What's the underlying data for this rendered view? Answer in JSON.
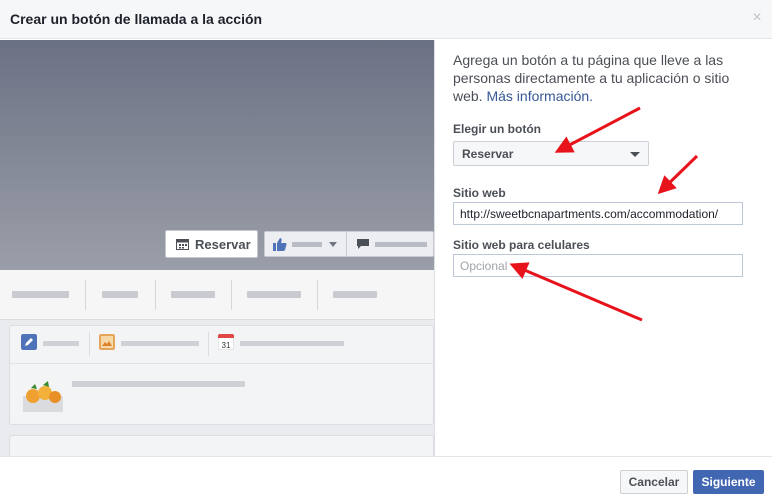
{
  "dialog": {
    "title": "Crear un botón de llamada a la acción",
    "close_label": "×"
  },
  "preview": {
    "cta_button_label": "Reservar"
  },
  "form": {
    "intro_text": "Agrega un botón a tu página que lleve a las personas directamente a tu aplicación o sitio web.",
    "intro_link": "Más información.",
    "choose_button_label": "Elegir un botón",
    "choose_button_value": "Reservar",
    "website_label": "Sitio web",
    "website_value": "http://sweetbcnapartments.com/accommodation/",
    "mobile_website_label": "Sitio web para celulares",
    "mobile_website_placeholder": "Opcional"
  },
  "footer": {
    "cancel_label": "Cancelar",
    "next_label": "Siguiente"
  },
  "colors": {
    "primary": "#4267b2",
    "annotation": "#e8121b",
    "link": "#365899"
  }
}
